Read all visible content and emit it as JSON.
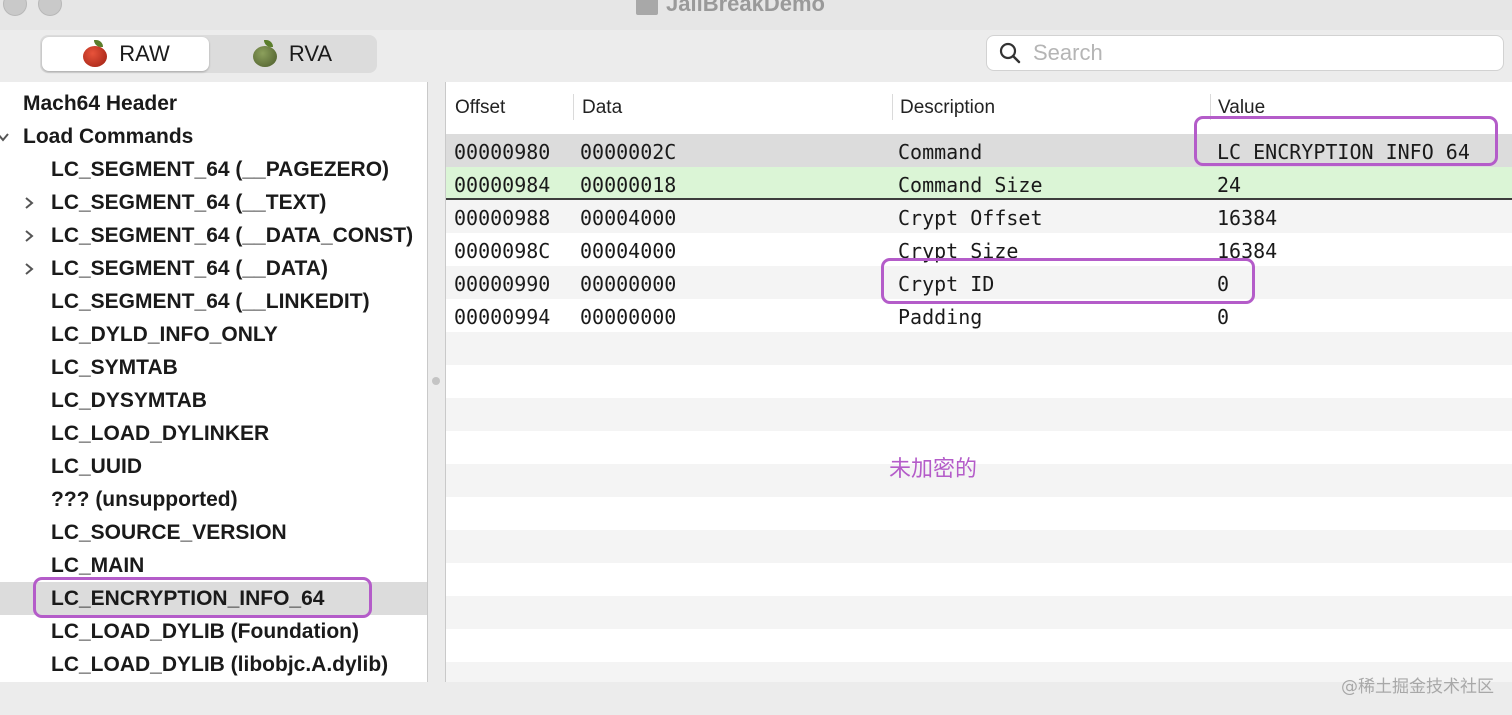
{
  "window": {
    "title": "JailBreakDemo"
  },
  "toolbar": {
    "modes": [
      {
        "label": "RAW",
        "icon": "red-apple-icon",
        "selected": true
      },
      {
        "label": "RVA",
        "icon": "green-apple-icon",
        "selected": false
      }
    ],
    "search": {
      "placeholder": "Search",
      "value": ""
    }
  },
  "sidebar": {
    "items": [
      {
        "label": "Mach64 Header",
        "level": 0,
        "disclosure": "none"
      },
      {
        "label": "Load Commands",
        "level": 0,
        "disclosure": "expanded"
      },
      {
        "label": "LC_SEGMENT_64 (__PAGEZERO)",
        "level": 1,
        "disclosure": "none"
      },
      {
        "label": "LC_SEGMENT_64 (__TEXT)",
        "level": 1,
        "disclosure": "collapsed"
      },
      {
        "label": "LC_SEGMENT_64 (__DATA_CONST)",
        "level": 1,
        "disclosure": "collapsed"
      },
      {
        "label": "LC_SEGMENT_64 (__DATA)",
        "level": 1,
        "disclosure": "collapsed"
      },
      {
        "label": "LC_SEGMENT_64 (__LINKEDIT)",
        "level": 1,
        "disclosure": "none"
      },
      {
        "label": "LC_DYLD_INFO_ONLY",
        "level": 1,
        "disclosure": "none"
      },
      {
        "label": "LC_SYMTAB",
        "level": 1,
        "disclosure": "none"
      },
      {
        "label": "LC_DYSYMTAB",
        "level": 1,
        "disclosure": "none"
      },
      {
        "label": "LC_LOAD_DYLINKER",
        "level": 1,
        "disclosure": "none"
      },
      {
        "label": "LC_UUID",
        "level": 1,
        "disclosure": "none"
      },
      {
        "label": "??? (unsupported)",
        "level": 1,
        "disclosure": "none"
      },
      {
        "label": "LC_SOURCE_VERSION",
        "level": 1,
        "disclosure": "none"
      },
      {
        "label": "LC_MAIN",
        "level": 1,
        "disclosure": "none"
      },
      {
        "label": "LC_ENCRYPTION_INFO_64",
        "level": 1,
        "disclosure": "none",
        "selected": true
      },
      {
        "label": "LC_LOAD_DYLIB (Foundation)",
        "level": 1,
        "disclosure": "none"
      },
      {
        "label": "LC_LOAD_DYLIB (libobjc.A.dylib)",
        "level": 1,
        "disclosure": "none"
      }
    ]
  },
  "table": {
    "columns": [
      "Offset",
      "Data",
      "Description",
      "Value"
    ],
    "rows": [
      {
        "offset": "00000980",
        "data": "0000002C",
        "description": "Command",
        "value": "LC_ENCRYPTION_INFO_64",
        "state": "selected"
      },
      {
        "offset": "00000984",
        "data": "00000018",
        "description": "Command Size",
        "value": "24",
        "state": "highlight"
      },
      {
        "offset": "00000988",
        "data": "00004000",
        "description": "Crypt Offset",
        "value": "16384",
        "state": "normal"
      },
      {
        "offset": "0000098C",
        "data": "00004000",
        "description": "Crypt Size",
        "value": "16384",
        "state": "normal"
      },
      {
        "offset": "00000990",
        "data": "00000000",
        "description": "Crypt ID",
        "value": "0",
        "state": "normal"
      },
      {
        "offset": "00000994",
        "data": "00000000",
        "description": "Padding",
        "value": "0",
        "state": "normal"
      }
    ]
  },
  "annotation": {
    "text": "未加密的",
    "color": "#b45cc9"
  },
  "watermark": "@稀土掘金技术社区"
}
